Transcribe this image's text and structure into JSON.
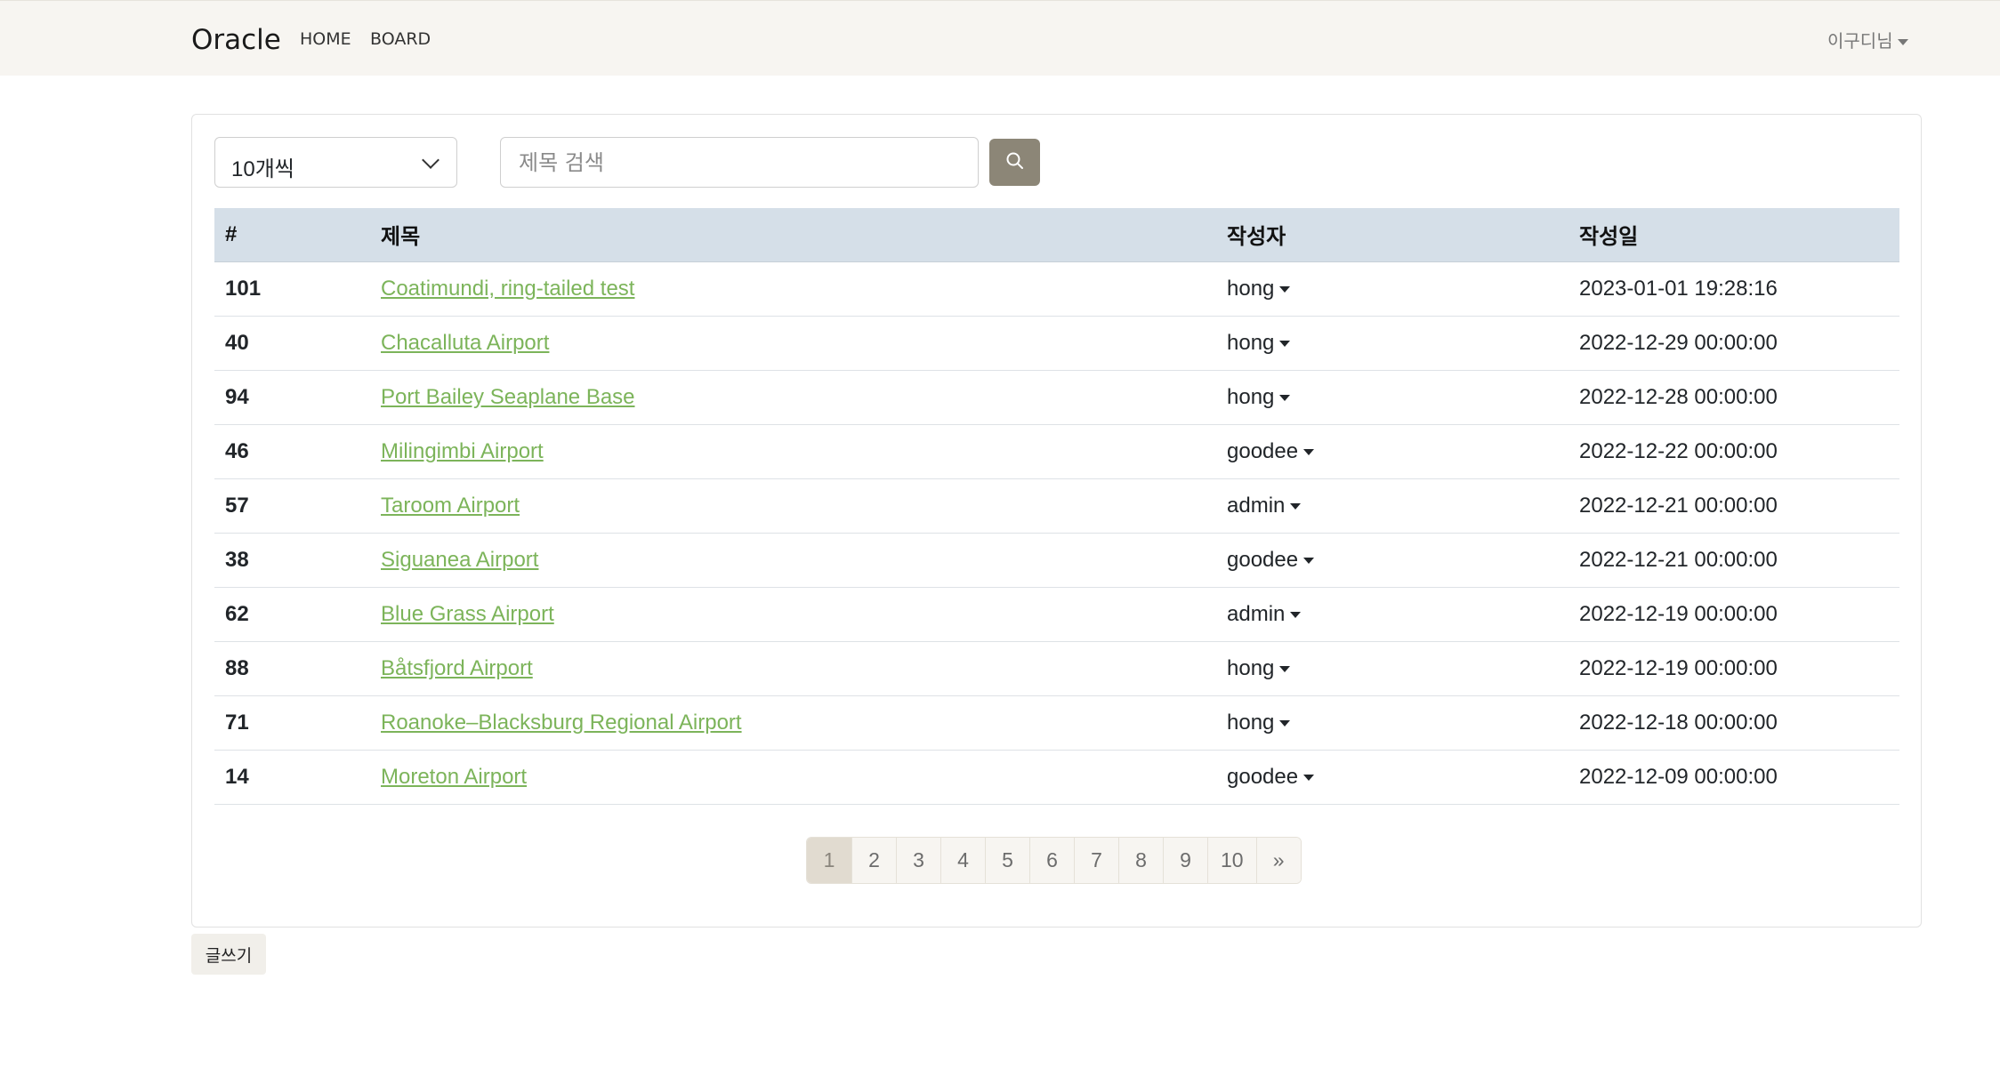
{
  "navbar": {
    "brand": "Oracle",
    "links": [
      "HOME",
      "BOARD"
    ],
    "user": "이구디님"
  },
  "filters": {
    "page_size": "10개씩",
    "search_placeholder": "제목 검색"
  },
  "table": {
    "headers": [
      "#",
      "제목",
      "작성자",
      "작성일"
    ],
    "rows": [
      {
        "num": "101",
        "title": "Coatimundi, ring-tailed test",
        "writer": "hong",
        "date": "2023-01-01 19:28:16"
      },
      {
        "num": "40",
        "title": "Chacalluta Airport",
        "writer": "hong",
        "date": "2022-12-29 00:00:00"
      },
      {
        "num": "94",
        "title": "Port Bailey Seaplane Base",
        "writer": "hong",
        "date": "2022-12-28 00:00:00"
      },
      {
        "num": "46",
        "title": "Milingimbi Airport",
        "writer": "goodee",
        "date": "2022-12-22 00:00:00"
      },
      {
        "num": "57",
        "title": "Taroom Airport",
        "writer": "admin",
        "date": "2022-12-21 00:00:00"
      },
      {
        "num": "38",
        "title": "Siguanea Airport",
        "writer": "goodee",
        "date": "2022-12-21 00:00:00"
      },
      {
        "num": "62",
        "title": "Blue Grass Airport",
        "writer": "admin",
        "date": "2022-12-19 00:00:00"
      },
      {
        "num": "88",
        "title": "Båtsfjord Airport",
        "writer": "hong",
        "date": "2022-12-19 00:00:00"
      },
      {
        "num": "71",
        "title": "Roanoke–Blacksburg Regional Airport",
        "writer": "hong",
        "date": "2022-12-18 00:00:00"
      },
      {
        "num": "14",
        "title": "Moreton Airport",
        "writer": "goodee",
        "date": "2022-12-09 00:00:00"
      }
    ]
  },
  "pagination": {
    "pages": [
      "1",
      "2",
      "3",
      "4",
      "5",
      "6",
      "7",
      "8",
      "9",
      "10"
    ],
    "current": "1",
    "next": "»"
  },
  "write_button": "글쓰기",
  "colors": {
    "navbar_bg": "#f7f5f1",
    "header_bg": "#d5dfe8",
    "link": "#7cb45a",
    "search_button": "#8c8677",
    "active_page": "#e1dbd0"
  },
  "icons": {
    "search": "search-icon",
    "select": "chevron-down-icon",
    "dropdown": "caret-down-icon"
  }
}
